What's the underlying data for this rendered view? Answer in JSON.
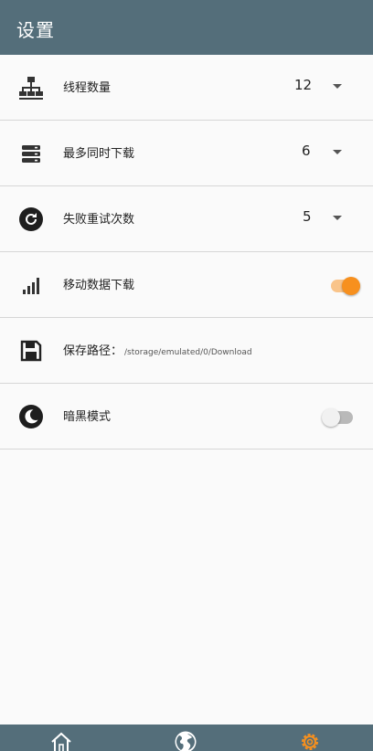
{
  "appbar": {
    "title": "设置"
  },
  "settings": {
    "threads": {
      "label": "线程数量",
      "value": "12",
      "icon": "network-tree-icon"
    },
    "max_downloads": {
      "label": "最多同时下载",
      "value": "6",
      "icon": "storage-stack-icon"
    },
    "retries": {
      "label": "失败重试次数",
      "value": "5",
      "icon": "refresh-icon"
    },
    "mobile_data": {
      "label": "移动数据下载",
      "enabled": true,
      "icon": "signal-bars-icon"
    },
    "save_path": {
      "label": "保存路径：",
      "value": "/storage/emulated/0/Download",
      "icon": "floppy-disk-icon"
    },
    "dark_mode": {
      "label": "暗黑模式",
      "enabled": false,
      "icon": "moon-icon"
    }
  },
  "bottom_nav": {
    "items": [
      {
        "name": "home",
        "icon": "home-icon",
        "active": false
      },
      {
        "name": "browse",
        "icon": "globe-icon",
        "active": false
      },
      {
        "name": "settings",
        "icon": "gear-icon",
        "active": true
      }
    ]
  },
  "colors": {
    "appbar": "#546e7a",
    "accent": "#f7901e",
    "accent_track": "#f9c48a",
    "off_thumb": "#f1f1f1",
    "off_track": "#b9b9b9"
  }
}
